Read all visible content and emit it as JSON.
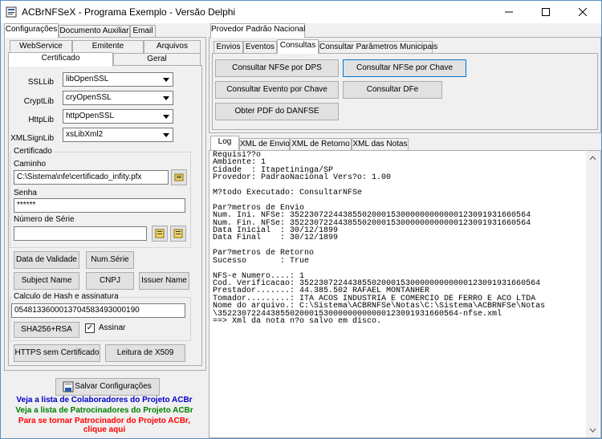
{
  "window": {
    "title": "ACBrNFSeX - Programa Exemplo - Versão Delphi",
    "minimize": "—",
    "maximize": "☐",
    "close": "✕"
  },
  "left_tabs": [
    "Configurações",
    "Documento Auxiliar",
    "Email"
  ],
  "config_tabs_row1": [
    "WebService",
    "Emitente",
    "Arquivos"
  ],
  "config_tabs_row2": [
    "Certificado",
    "Geral"
  ],
  "fields": {
    "ssllib_label": "SSLLib",
    "ssllib_value": "libOpenSSL",
    "cryptlib_label": "CryptLib",
    "cryptlib_value": "cryOpenSSL",
    "httplib_label": "HttpLib",
    "httplib_value": "httpOpenSSL",
    "xmlsignlib_label": "XMLSignLib",
    "xmlsignlib_value": "xsLibXml2"
  },
  "certificado": {
    "group_title": "Certificado",
    "caminho_label": "Caminho",
    "caminho_value": "C:\\Sistema\\nfe\\certificado_infity.pfx",
    "senha_label": "Senha",
    "senha_value": "******",
    "numero_serie_label": "Número de Série",
    "numero_serie_value": ""
  },
  "cert_buttons": {
    "data_validade": "Data de Validade",
    "num_serie": "Num.Série",
    "subject_name": "Subject Name",
    "cnpj": "CNPJ",
    "issuer_name": "Issuer Name"
  },
  "hash": {
    "group_title": "Calculo de Hash e assinatura",
    "value": "0548133600013704583493000190",
    "sha_button": "SHA256+RSA",
    "assinar_label": "Assinar",
    "assinar_checked": "✓"
  },
  "bottom_buttons": {
    "https": "HTTPS sem Certificado",
    "leitura": "Leitura de X509"
  },
  "salvar": "Salvar Configurações",
  "links": {
    "colaboradores": "Veja a lista de Colaboradores do Projeto ACBr",
    "patrocinadores": "Veja a lista de Patrocinadores do Projeto ACBr",
    "patrocinador_line1": "Para se tornar Patrocinador do Projeto ACBr,",
    "patrocinador_line2": "clique aqui",
    "colors": {
      "blue": "#0000cc",
      "green": "#008000",
      "red": "#ff0000"
    }
  },
  "right": {
    "provider_tab": "Provedor Padrão Nacional",
    "sub_tabs": [
      "Envios",
      "Eventos",
      "Consultas",
      "Consultar Parâmetros Municipais"
    ],
    "buttons": {
      "consultar_dps": "Consultar NFSe por DPS",
      "consultar_chave": "Consultar NFSe por Chave",
      "consultar_evento": "Consultar Evento por Chave",
      "consultar_dfe": "Consultar DFe",
      "obter_pdf": "Obter PDF do DANFSE"
    },
    "log_tabs": [
      "Log",
      "XML de Envio",
      "XML de Retorno",
      "XML das Notas"
    ]
  },
  "log_lines": [
    "Requisi??o",
    "Ambiente: 1",
    "Cidade  : Itapetininga/SP",
    "Provedor: PadraoNacional Vers?o: 1.00",
    "",
    "M?todo Executado: ConsultarNFSe",
    "",
    "Par?metros de Envio",
    "Num. Ini. NFSe: 35223072244385502000153000000000000123091931660564",
    "Num. Fin. NFSe: 35223072244385502000153000000000000123091931660564",
    "Data Inicial  : 30/12/1899",
    "Data Final    : 30/12/1899",
    "",
    "Par?metros de Retorno",
    "Sucesso       : True",
    "",
    "NFS-e Numero....: 1",
    "Cod. Verificacao: 35223072244385502000153000000000000123091931660564",
    "Prestador.......: 44.385.502 RAFAEL MONTANHER",
    "Tomador.........: ITA ACOS INDUSTRIA E COMERCIO DE FERRO E ACO LTDA",
    "Nome do arquivo.: C:\\Sistema\\ACBRNFSe\\Notas\\C:\\Sistema\\ACBRNFSe\\Notas",
    "\\35223072244385502000153000000000000123091931660564-nfse.xml",
    "==> Xml da nota n?o salvo em disco."
  ]
}
